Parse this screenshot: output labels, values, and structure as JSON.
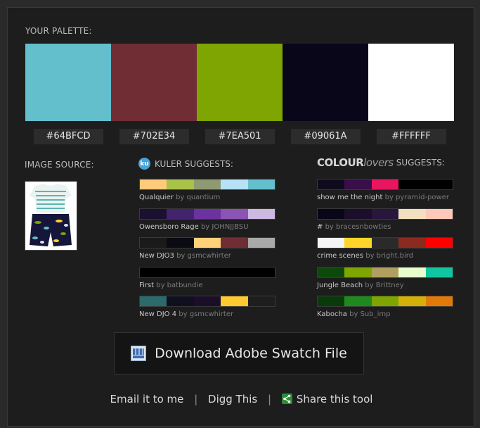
{
  "palette": {
    "label": "YOUR PALETTE:",
    "swatches": [
      {
        "hex": "#64BFCD",
        "color": "#64BFCD"
      },
      {
        "hex": "#702E34",
        "color": "#702E34"
      },
      {
        "hex": "#7EA501",
        "color": "#7EA501"
      },
      {
        "hex": "#09061A",
        "color": "#09061A"
      },
      {
        "hex": "#FFFFFF",
        "color": "#FFFFFF"
      }
    ]
  },
  "image_source": {
    "label": "IMAGE SOURCE:"
  },
  "kuler": {
    "heading": "KULER SUGGESTS:",
    "icon_text": "ku",
    "items": [
      {
        "name": "Qualquier",
        "by": "by quantium",
        "colors": [
          "#FFCB7A",
          "#A9C24A",
          "#8F9A73",
          "#B7E1F6",
          "#64BFCD"
        ]
      },
      {
        "name": "Owensboro Rage",
        "by": "by JOHNJJBSU",
        "colors": [
          "#1B1030",
          "#43236E",
          "#6B32A0",
          "#8A53B5",
          "#CDB8E2"
        ]
      },
      {
        "name": "New DJO3",
        "by": "by gsmcwhirter",
        "colors": [
          "#1A1A1A",
          "#0A0A12",
          "#FFD27A",
          "#702E34",
          "#A9A9A9"
        ]
      },
      {
        "name": "First",
        "by": "by batbundie",
        "colors": [
          "#000000",
          "#000000",
          "#000000",
          "#000000",
          "#000000"
        ]
      },
      {
        "name": "New DJO 4",
        "by": "by gsmcwhirter",
        "colors": [
          "#2B6B6B",
          "#0F0F1F",
          "#1A0E28",
          "#FFC930",
          "#1E1E1E"
        ]
      }
    ]
  },
  "colourlovers": {
    "logo_bold": "COLOUR",
    "logo_light": "lovers",
    "heading": "SUGGESTS:",
    "items": [
      {
        "name": "show me the night",
        "by": "by pyramid-power",
        "colors": [
          "#0F0A1E",
          "#3A0E4A",
          "#E8155F",
          "#000000",
          "#000000"
        ]
      },
      {
        "name": "#",
        "by": "by bracesnbowties",
        "colors": [
          "#09061A",
          "#1A0E2B",
          "#28163C",
          "#F2E0C0",
          "#FFC8B8"
        ]
      },
      {
        "name": "crime scenes",
        "by": "by bright.bird",
        "colors": [
          "#F4F4F4",
          "#FFD52A",
          "#2A2A2A",
          "#8B2A1E",
          "#FF0000"
        ]
      },
      {
        "name": "Jungle Beach",
        "by": "by Brittney",
        "colors": [
          "#0B4A0B",
          "#7EA501",
          "#B0A060",
          "#E6FFCC",
          "#10C6A0"
        ]
      },
      {
        "name": "Kabocha",
        "by": "by Sub_imp",
        "colors": [
          "#0A3A0A",
          "#1E8A1E",
          "#7EA501",
          "#D4B008",
          "#E27A0A"
        ]
      }
    ]
  },
  "download": {
    "label": "Download Adobe Swatch File"
  },
  "footer": {
    "email": "Email it to me",
    "sep1": "|",
    "digg": "Digg This",
    "sep2": "|",
    "share": "Share this tool"
  }
}
